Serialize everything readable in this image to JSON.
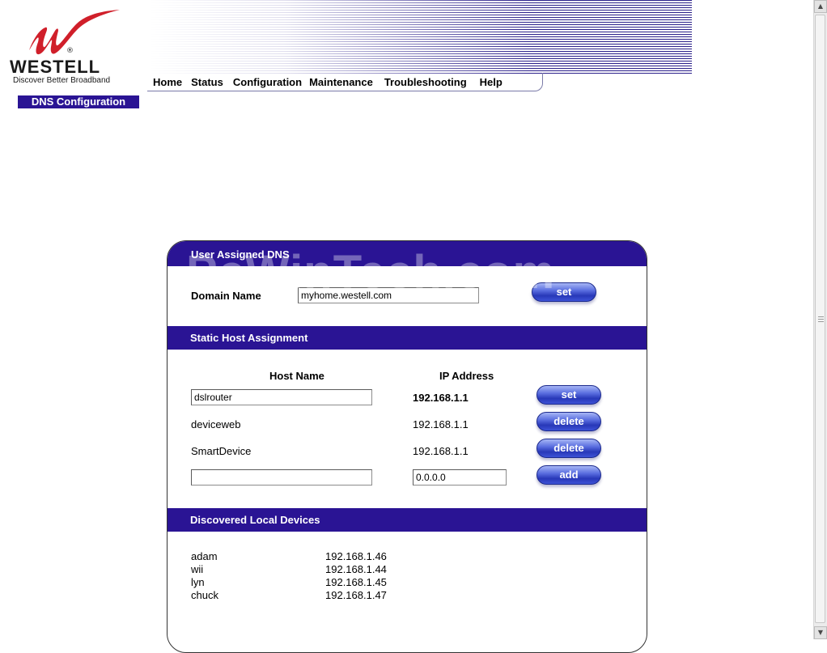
{
  "brand": {
    "name": "WESTELL",
    "registered": "®",
    "tagline": "Discover  Better  Broadband",
    "logo_color": "#d01f2a"
  },
  "nav": {
    "items": [
      "Home",
      "Status",
      "Configuration",
      "Maintenance",
      "Troubleshooting",
      "Help"
    ]
  },
  "page_tab": "DNS Configuration",
  "watermark": "PcWinTech.com",
  "user_dns": {
    "header": "User Assigned DNS",
    "domain_label": "Domain Name",
    "domain_value": "myhome.westell.com",
    "set_label": "set"
  },
  "static_hosts": {
    "header": "Static Host Assignment",
    "col_host": "Host Name",
    "col_ip": "IP Address",
    "row1": {
      "host": "dslrouter",
      "ip": "192.168.1.1",
      "button": "set"
    },
    "row2": {
      "host": "deviceweb",
      "ip": "192.168.1.1",
      "button": "delete"
    },
    "row3": {
      "host": "SmartDevice",
      "ip": "192.168.1.1",
      "button": "delete"
    },
    "row4": {
      "host": "",
      "ip": "0.0.0.0",
      "button": "add"
    }
  },
  "discovered": {
    "header": "Discovered Local Devices",
    "devices": [
      {
        "name": "adam",
        "ip": "192.168.1.46"
      },
      {
        "name": "wii",
        "ip": "192.168.1.44"
      },
      {
        "name": "lyn",
        "ip": "192.168.1.45"
      },
      {
        "name": "chuck",
        "ip": "192.168.1.47"
      }
    ]
  },
  "colors": {
    "header_bg": "#2a1494",
    "button_blue": "#2838b8"
  }
}
